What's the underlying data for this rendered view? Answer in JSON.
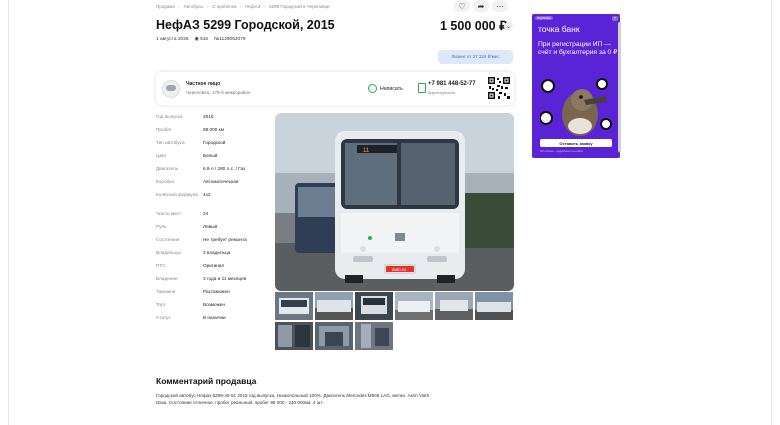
{
  "breadcrumbs": [
    "Продажа",
    "Автобусы",
    "С пробегом",
    "НефАЗ",
    "5299 Городской в Череповце"
  ],
  "title": "НефАЗ 5299 Городской, 2015",
  "price": "1 500 000 ₽",
  "meta": {
    "date": "1 августа 2025",
    "views": "516",
    "id": "№1129062079"
  },
  "leasing": "Лизинг от 27 324 ₽/мес",
  "seller": {
    "type": "Частное лицо",
    "location": "Череповец, 178-й микрорайон",
    "write_label": "Написать",
    "phone": "+7 981 448-52-77",
    "phone_sub": "Круглосуточно"
  },
  "specs": [
    {
      "k": "Год выпуска",
      "v": "2015"
    },
    {
      "k": "Пробег",
      "v": "98 000 км"
    },
    {
      "k": "Тип автобуса",
      "v": "Городской"
    },
    {
      "k": "Цвет",
      "v": "Белый"
    },
    {
      "k": "Двигатель",
      "v": "6.9 л / 280 л.с. / Газ"
    },
    {
      "k": "Коробка",
      "v": "Автоматическая"
    },
    {
      "k": "Колёсная формула",
      "v": "4x2"
    },
    {
      "k": "Число мест",
      "v": "24"
    },
    {
      "k": "Руль",
      "v": "Левый"
    },
    {
      "k": "Состояние",
      "v": "Не требует ремонта"
    },
    {
      "k": "Владельцы",
      "v": "3 владельца"
    },
    {
      "k": "ПТС",
      "v": "Оригинал"
    },
    {
      "k": "Владение",
      "v": "3 года и 11 месяцев"
    },
    {
      "k": "Таможня",
      "v": "Растаможен"
    },
    {
      "k": "Торг",
      "v": "Возможен"
    },
    {
      "k": "Статус",
      "v": "В наличии"
    }
  ],
  "bus_plate": "auto.ru",
  "bus_route": "11",
  "comment": {
    "title": "Комментарий продавца",
    "text": "Городской автобус Нефаз 5299-40-51 2015 год выпуска. Низкопольный 100%. Двигатель Mercedes M906 LAG, метан. Акпп Voith Diwa. Состояние отличное, пробег реальный. пробег 98 000 - 240 000км. 4 шт."
  },
  "ad": {
    "badge": "РЕКЛАМА",
    "close": "×",
    "brand": "точка банк",
    "headline": "При регистрации ИП — счёт и бухгалтерия за 0 ₽",
    "button": "Оставить заявку",
    "fine": "АО «Точка» · подробности на сайте"
  },
  "colors": {
    "accent_green": "#2cae47",
    "ad_purple": "#5b23d6",
    "leasing_bg": "#dde9fb"
  }
}
